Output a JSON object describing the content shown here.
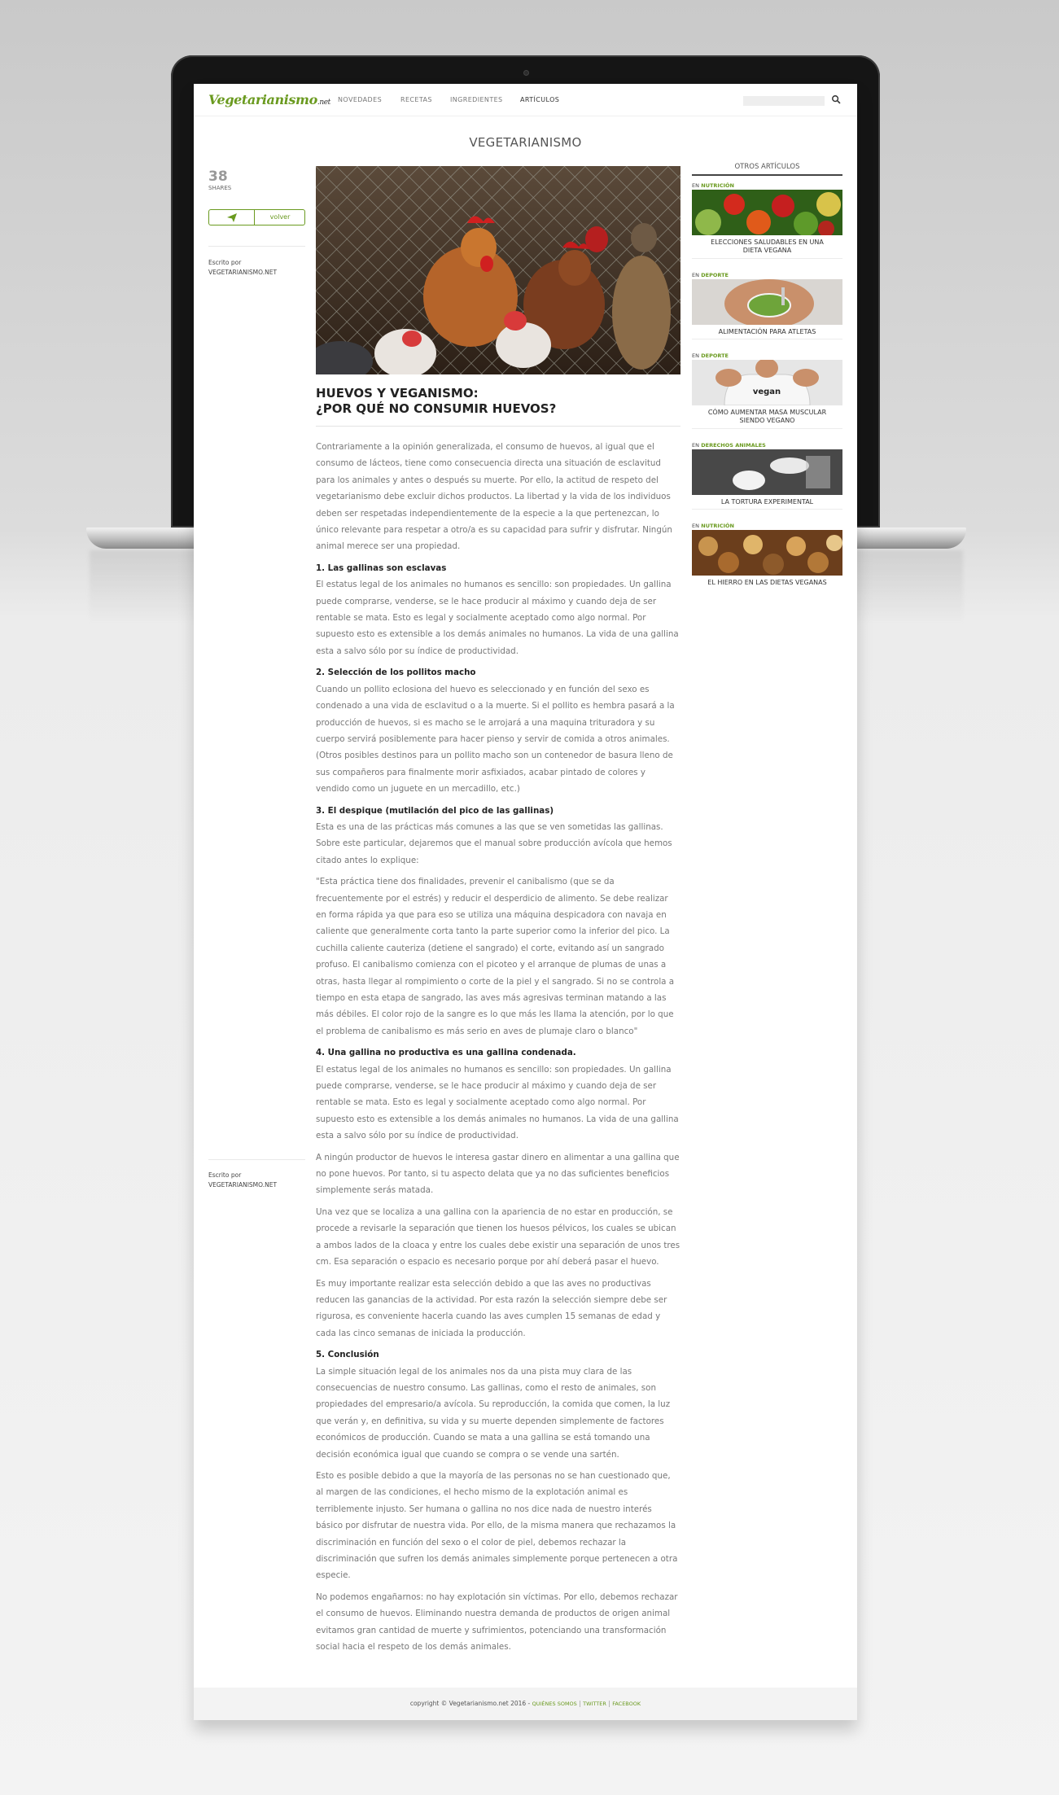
{
  "nav": {
    "logo_main": "Vegetarianismo",
    "logo_suffix": ".net",
    "items": [
      "NOVEDADES",
      "RECETAS",
      "INGREDIENTES",
      "ARTÍCULOS"
    ],
    "search_placeholder": ""
  },
  "section_title": "VEGETARIANISMO",
  "share": {
    "count": "38",
    "label": "SHARES",
    "volver": "volver"
  },
  "author": {
    "label": "Escrito por",
    "name": "VEGETARIANISMO.NET"
  },
  "article": {
    "title_line1": "HUEVOS Y VEGANISMO:",
    "title_line2": "¿POR QUÉ NO CONSUMIR HUEVOS?",
    "intro": "Contrariamente a la opinión generalizada, el consumo de huevos, al igual que el consumo de lácteos, tiene como consecuencia directa una situación de esclavitud para los animales y antes o después su muerte. Por ello, la actitud de respeto del vegetarianismo debe excluir dichos productos. La libertad y la vida de los individuos deben ser respetadas independientemente de la especie a la que pertenezcan, lo único relevante para respetar a otro/a es su capacidad para sufrir y disfrutar. Ningún animal merece ser una propiedad.",
    "h1": "1. Las gallinas son esclavas",
    "p1": "El estatus legal de los animales no humanos es sencillo: son propiedades. Un gallina puede comprarse, venderse, se le hace producir al máximo y cuando deja de ser rentable se mata. Esto es legal y socialmente aceptado como algo normal. Por supuesto esto es extensible a los demás animales no humanos. La vida de una gallina esta a salvo sólo por su índice de productividad.",
    "h2": "2. Selección de los pollitos macho",
    "p2": "Cuando un pollito eclosiona del huevo es seleccionado y en función del sexo es condenado a una vida de esclavitud o a la muerte. Si el pollito es hembra pasará a la producción de huevos, si es macho se le arrojará a una maquina trituradora y su cuerpo servirá posiblemente para hacer pienso y servir de comida a otros animales. (Otros posibles destinos para un pollito macho son un contenedor de basura lleno de sus compañeros para finalmente morir asfixiados, acabar pintado de colores y vendido como un juguete en un mercadillo, etc.)",
    "h3": "3. El despique (mutilación del pico de las gallinas)",
    "p3": "Esta es una de las prácticas más comunes a las que se ven sometidas las gallinas. Sobre este particular, dejaremos que el manual sobre producción avícola que hemos citado antes lo explique:",
    "quote": "\"Esta práctica tiene dos finalidades, prevenir el canibalismo (que se da frecuentemente por el estrés) y reducir el desperdicio de alimento. Se debe realizar en forma rápida ya que para eso se utiliza una máquina despicadora con navaja en caliente que generalmente corta tanto la parte superior como la inferior del pico. La cuchilla caliente cauteriza (detiene el sangrado) el corte, evitando así un sangrado profuso. El canibalismo comienza con el picoteo y el arranque de plumas de unas a otras, hasta llegar al rompimiento o corte de la piel y el sangrado. Si no se controla a tiempo en esta etapa de sangrado, las aves más agresivas terminan matando a las más débiles. El color rojo de la sangre es lo que más les llama la atención, por lo que el problema de canibalismo es más serio en aves de plumaje claro o blanco\"",
    "h4": "4. Una gallina no productiva es una gallina condenada.",
    "p4a": "El estatus legal de los animales no humanos es sencillo: son propiedades. Un gallina puede comprarse, venderse, se le hace producir al máximo y cuando deja de ser rentable se mata. Esto es legal y socialmente aceptado como algo normal. Por supuesto esto es extensible a los demás animales no humanos. La vida de una gallina esta a salvo sólo por su índice de productividad.",
    "p4b": "A ningún productor de huevos le interesa gastar dinero en alimentar a una gallina que no pone huevos. Por tanto, si tu aspecto delata que ya no das suficientes beneficios simplemente serás matada.",
    "p4c": "Una vez que se localiza a una gallina con la apariencia de no estar en producción, se procede a revisarle la separación que tienen los huesos pélvicos, los cuales se ubican a ambos lados de la cloaca y entre los cuales debe existir una separación de unos tres cm. Esa separación o espacio es necesario porque por ahí deberá pasar el huevo.",
    "p4d": "Es muy importante realizar esta selección debido a que las aves no productivas reducen las ganancias de la actividad. Por esta razón la selección siempre debe ser rigurosa, es conveniente hacerla cuando las aves cumplen 15 semanas de edad y cada las cinco semanas de iniciada la producción.",
    "h5": "5. Conclusión",
    "p5a": "La simple situación legal de los animales nos da una pista muy clara de las consecuencias de nuestro consumo. Las gallinas, como el resto de animales, son propiedades del empresario/a avícola. Su reproducción, la comida que comen, la luz que verán y, en definitiva, su vida y su muerte dependen simplemente de factores económicos de producción. Cuando se mata a una gallina se está tomando una decisión económica igual que cuando se compra o se vende una sartén.",
    "p5b": "Esto es posible debido a que la mayoría de las personas no se han cuestionado que, al margen de las condiciones, el hecho mismo de la explotación animal es terriblemente injusto. Ser humana o gallina no nos dice nada de nuestro interés básico por disfrutar de nuestra vida. Por ello, de la misma manera que rechazamos la discriminación en función del sexo o el color de piel, debemos rechazar la discriminación que sufren los demás animales simplemente porque pertenecen a otra especie.",
    "p5c": "No podemos engañarnos: no hay explotación sin víctimas. Por ello, debemos rechazar el consumo de huevos. Eliminando nuestra demanda de productos de origen animal evitamos gran cantidad de muerte y sufrimientos, potenciando una transformación social hacia el respeto de los demás animales."
  },
  "sidebar": {
    "title": "OTROS ARTÍCULOS",
    "items": [
      {
        "prefix": "EN",
        "category": "NUTRICIÓN",
        "title": "ELECCIONES SALUDABLES EN UNA DIETA VEGANA"
      },
      {
        "prefix": "EN",
        "category": "DEPORTE",
        "title": "ALIMENTACIÓN PARA ATLETAS"
      },
      {
        "prefix": "EN",
        "category": "DEPORTE",
        "title": "CÓMO AUMENTAR MASA MUSCULAR SIENDO VEGANO",
        "shirt_text": "vegan"
      },
      {
        "prefix": "EN",
        "category": "DERECHOS ANIMALES",
        "title": "LA TORTURA EXPERIMENTAL"
      },
      {
        "prefix": "EN",
        "category": "NUTRICIÓN",
        "title": "EL HIERRO EN LAS DIETAS VEGANAS"
      }
    ]
  },
  "footer": {
    "copyright": "copyright © Vegetarianismo.net 2016 -",
    "link1": "QUIÉNES SOMOS",
    "sep": "|",
    "link2": "TWITTER",
    "link3": "FACEBOOK"
  },
  "colors": {
    "brand_green": "#6a9a1f",
    "text_gray": "#777777",
    "dark": "#222222"
  },
  "icons": {
    "search": "search-icon",
    "share": "paper-plane-icon"
  }
}
